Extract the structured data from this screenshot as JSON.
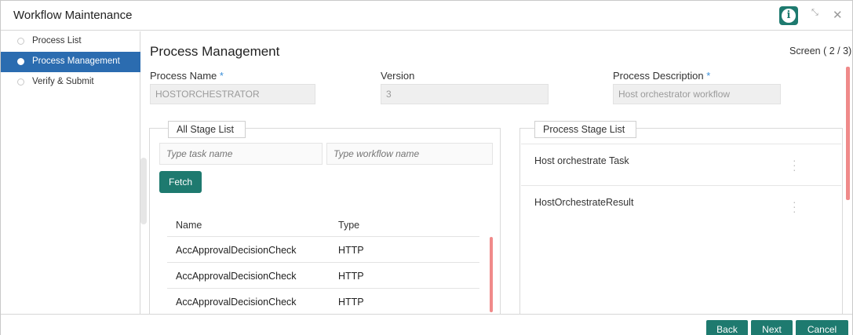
{
  "window": {
    "title": "Workflow Maintenance",
    "info_icon": "info-icon",
    "minimize_glyph": "⤡",
    "close_glyph": "✕"
  },
  "sidebar": {
    "items": [
      {
        "label": "Process List",
        "active": false
      },
      {
        "label": "Process Management",
        "active": true
      },
      {
        "label": "Verify & Submit",
        "active": false
      }
    ]
  },
  "main": {
    "title": "Process Management",
    "screen_indicator": "Screen ( 2 / 3)",
    "fields": {
      "process_name": {
        "label": "Process Name",
        "required_mark": "*",
        "value": "HOSTORCHESTRATOR"
      },
      "version": {
        "label": "Version",
        "value": "3"
      },
      "process_description": {
        "label": "Process Description",
        "required_mark": "*",
        "value": "Host orchestrator workflow"
      }
    }
  },
  "all_stage_list": {
    "legend": "All Stage List",
    "task_name_placeholder": "Type task name",
    "workflow_name_placeholder": "Type workflow name",
    "fetch_label": "Fetch",
    "columns": [
      "Name",
      "Type"
    ],
    "rows": [
      {
        "name": "AccApprovalDecisionCheck",
        "type": "HTTP"
      },
      {
        "name": "AccApprovalDecisionCheck",
        "type": "HTTP"
      },
      {
        "name": "AccApprovalDecisionCheck",
        "type": "HTTP"
      }
    ]
  },
  "process_stage_list": {
    "legend": "Process Stage List",
    "items": [
      {
        "name": "Host orchestrate Task"
      },
      {
        "name": "HostOrchestrateResult"
      }
    ]
  },
  "footer": {
    "back_label": "Back",
    "next_label": "Next",
    "cancel_label": "Cancel"
  },
  "colors": {
    "primary": "#1e7a6f",
    "active_nav": "#2b6cb0",
    "scroll_accent": "#f08a8a",
    "required": "#3a8fd9"
  }
}
